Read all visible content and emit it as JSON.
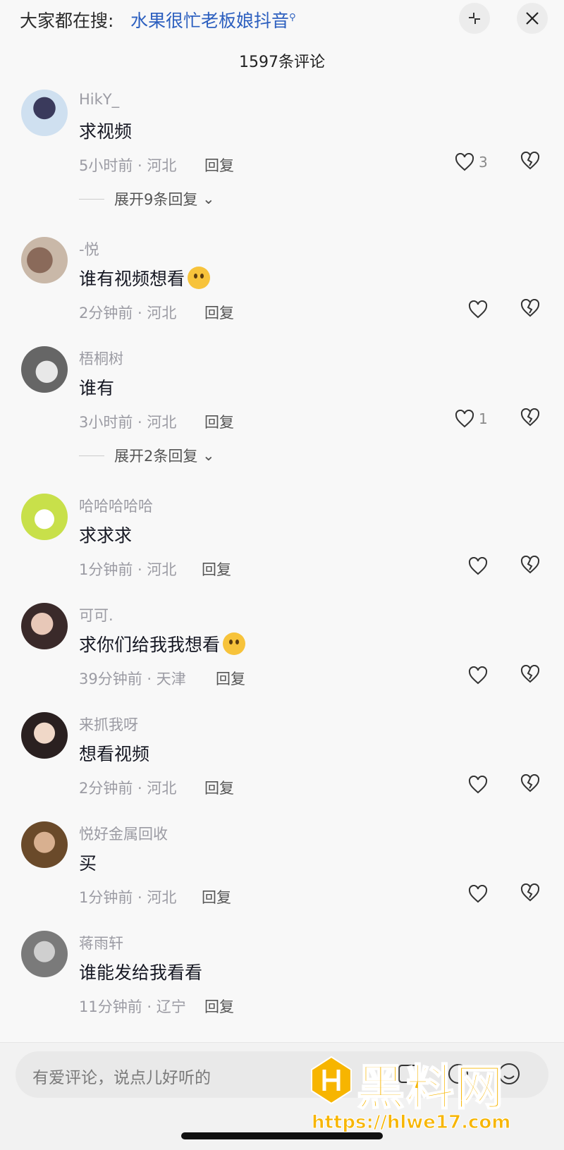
{
  "header": {
    "search_prefix": "大家都在搜:",
    "search_term": "水果很忙老板娘抖音",
    "comment_count_title": "1597条评论"
  },
  "comments": [
    {
      "username": "HikY_",
      "content": "求视频",
      "time_location": "5小时前 · 河北",
      "reply": "回复",
      "likes": "3",
      "expand": "展开9条回复"
    },
    {
      "username": "-悦",
      "content": "谁有视频想看",
      "time_location": "2分钟前 · 河北",
      "reply": "回复",
      "likes": "",
      "expand": ""
    },
    {
      "username": "梧桐树",
      "content": "谁有",
      "time_location": "3小时前 · 河北",
      "reply": "回复",
      "likes": "1",
      "expand": "展开2条回复"
    },
    {
      "username": "哈哈哈哈哈",
      "content": "求求求",
      "time_location": "1分钟前 · 河北",
      "reply": "回复",
      "likes": "",
      "expand": ""
    },
    {
      "username": "可可.",
      "content": "求你们给我我想看",
      "time_location": "39分钟前 · 天津",
      "reply": "回复",
      "likes": "",
      "expand": ""
    },
    {
      "username": "来抓我呀",
      "content": "想看视频",
      "time_location": "2分钟前 · 河北",
      "reply": "回复",
      "likes": "",
      "expand": ""
    },
    {
      "username": "悦好金属回收",
      "content": "买",
      "time_location": "1分钟前 · 河北",
      "reply": "回复",
      "likes": "",
      "expand": ""
    },
    {
      "username": "蒋雨轩",
      "content": "谁能发给我看看",
      "time_location": "11分钟前 · 辽宁",
      "reply": "回复",
      "likes": "",
      "expand": ""
    }
  ],
  "input": {
    "placeholder": "有爱评论，说点儿好听的"
  },
  "watermark": {
    "title": "黑料网",
    "url": "https://hlwe17.com"
  },
  "colors": {
    "link_blue": "#2c5fbf",
    "watermark_gold": "#f7b500"
  }
}
